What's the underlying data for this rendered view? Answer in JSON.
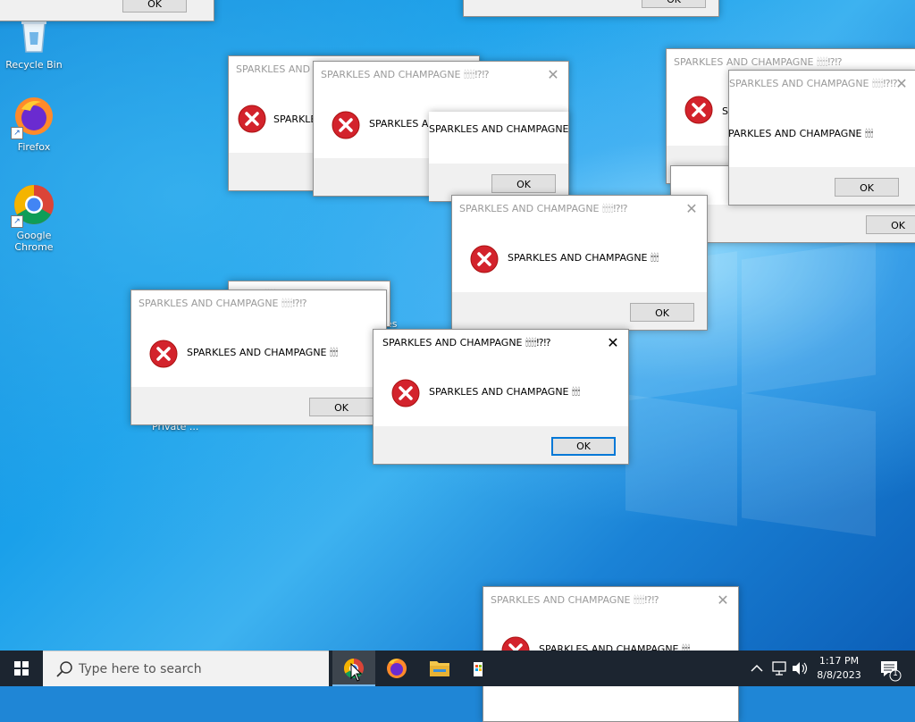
{
  "desktop": {
    "icons": [
      {
        "label": "Recycle Bin"
      },
      {
        "label": "Firefox"
      },
      {
        "label": "Google Chrome"
      }
    ],
    "partial_labels": [
      "Private ...",
      "es"
    ]
  },
  "dialogs": {
    "title": "SPARKLES AND CHAMPAGNE 🕯🕯🕯🕯⁉⁉",
    "message": "SPARKLES AND CHAMPAGNE 🕯🕯🕯",
    "ok_label": "OK",
    "close_label": "✕"
  },
  "taskbar": {
    "search_placeholder": "Type here to search",
    "time": "1:17 PM",
    "date": "8/8/2023",
    "notification_count": "1"
  },
  "colors": {
    "taskbar_bg": "#1c2530",
    "accent": "#0078d7",
    "error_red": "#d3232c"
  }
}
